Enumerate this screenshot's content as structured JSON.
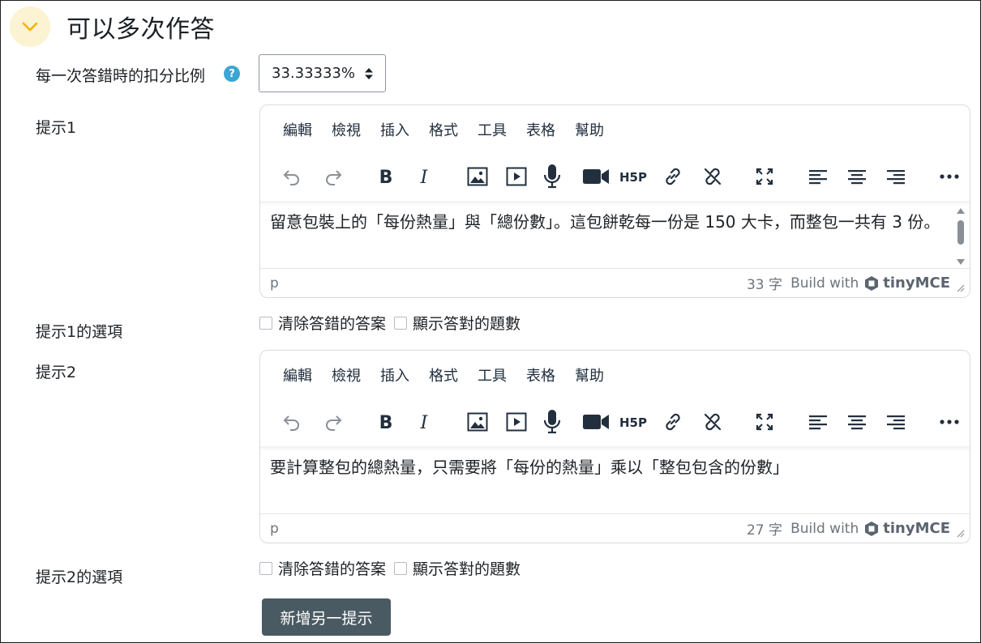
{
  "section": {
    "title": "可以多次作答"
  },
  "penalty": {
    "label": "每一次答錯時的扣分比例",
    "help_glyph": "?",
    "value": "33.33333%"
  },
  "menu": [
    "編輯",
    "檢視",
    "插入",
    "格式",
    "工具",
    "表格",
    "幫助"
  ],
  "hint1": {
    "label": "提示1",
    "content": "留意包裝上的「每份熱量」與「總份數」。這包餅乾每一份是 150 大卡，而整包一共有 3 份。",
    "path": "p",
    "count": "33 字",
    "build_with": "Build with",
    "brand": "tinyMCE",
    "options_label": "提示1的選項",
    "option_clear": "清除答錯的答案",
    "option_show": "顯示答對的題數"
  },
  "hint2": {
    "label": "提示2",
    "content": "要計算整包的總熱量，只需要將「每份的熱量」乘以「整包包含的份數」",
    "path": "p",
    "count": "27 字",
    "build_with": "Build with",
    "brand": "tinyMCE",
    "options_label": "提示2的選項",
    "option_clear": "清除答錯的答案",
    "option_show": "顯示答對的題數"
  },
  "add_hint_button": "新增另一提示",
  "colors": {
    "primary_button": "#4a5a63",
    "help_icon": "#3aa6d4",
    "collapse_bg": "#fbf3d2"
  }
}
